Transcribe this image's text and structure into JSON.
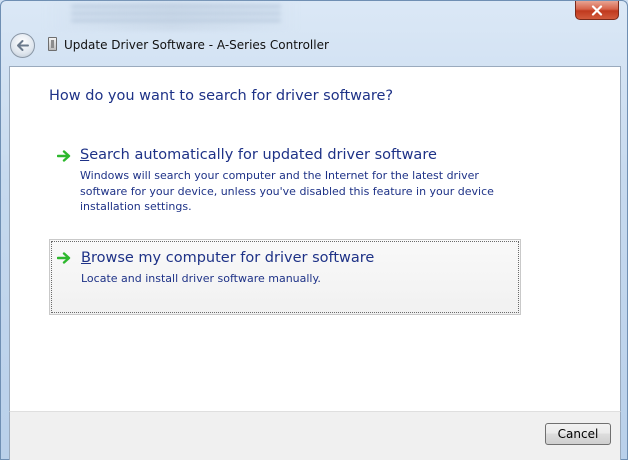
{
  "window": {
    "title": "Update Driver Software - A-Series Controller"
  },
  "icons": {
    "close": "close-icon",
    "back": "back-arrow-icon",
    "app": "device-icon",
    "option_arrow": "green-arrow-icon"
  },
  "colors": {
    "heading_text": "#1e3287",
    "arrow_green": "#2db82d",
    "close_red": "#c0391e"
  },
  "main": {
    "heading": "How do you want to search for driver software?",
    "options": [
      {
        "accel": "S",
        "title_rest": "earch automatically for updated driver software",
        "description": "Windows will search your computer and the Internet for the latest driver software for your device, unless you've disabled this feature in your device installation settings."
      },
      {
        "accel": "B",
        "title_rest": "rowse my computer for driver software",
        "description": "Locate and install driver software manually."
      }
    ]
  },
  "footer": {
    "cancel_label": "Cancel"
  }
}
